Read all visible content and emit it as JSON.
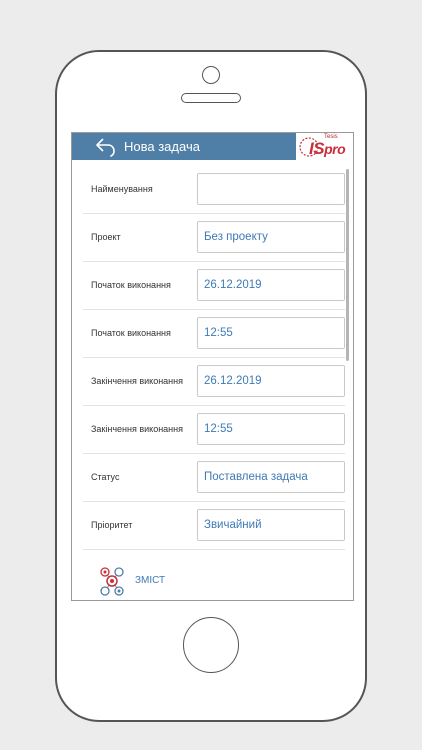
{
  "header": {
    "title": "Нова задача",
    "back_icon": "back-arrow-icon",
    "logo": {
      "top_text": "Tesis",
      "main_text": "IS",
      "suffix_text": "pro"
    }
  },
  "form": {
    "rows": [
      {
        "label": "Найменування",
        "value": ""
      },
      {
        "label": "Проект",
        "value": "Без проекту"
      },
      {
        "label": "Початок виконання",
        "value": "26.12.2019"
      },
      {
        "label": "Початок виконання",
        "value": "12:55"
      },
      {
        "label": "Закінчення виконання",
        "value": "26.12.2019"
      },
      {
        "label": "Закінчення виконання",
        "value": "12:55"
      },
      {
        "label": "Статус",
        "value": "Поставлена задача"
      },
      {
        "label": "Пріоритет",
        "value": "Звичайний"
      }
    ]
  },
  "footer": {
    "label": "ЗМІСТ",
    "icon": "task-targets-icon"
  },
  "colors": {
    "appbar": "#4f7fa6",
    "value_text": "#3f7ab5",
    "logo_red": "#c8303a"
  }
}
